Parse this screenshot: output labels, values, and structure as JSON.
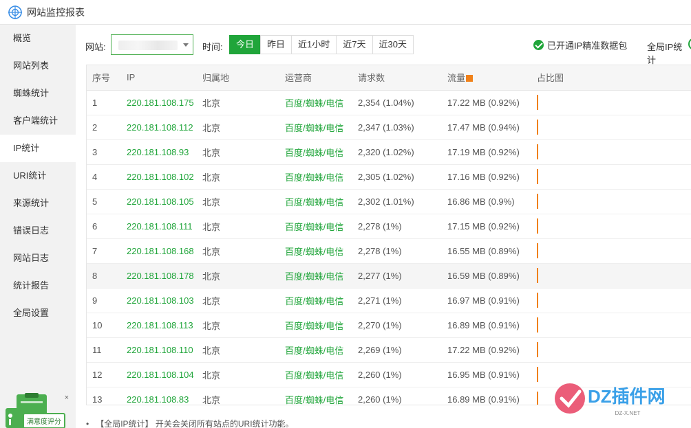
{
  "app": {
    "title": "网站监控报表"
  },
  "sidebar": {
    "items": [
      {
        "label": "概览"
      },
      {
        "label": "网站列表"
      },
      {
        "label": "蜘蛛统计"
      },
      {
        "label": "客户端统计"
      },
      {
        "label": "IP统计"
      },
      {
        "label": "URI统计"
      },
      {
        "label": "来源统计"
      },
      {
        "label": "错误日志"
      },
      {
        "label": "网站日志"
      },
      {
        "label": "统计报告"
      },
      {
        "label": "全局设置"
      }
    ],
    "active_index": 4
  },
  "promo": {
    "label": "满意度评分",
    "close": "×"
  },
  "toolbar": {
    "site_label": "网站:",
    "time_label": "时间:",
    "time_options": [
      "今日",
      "昨日",
      "近1小时",
      "近7天",
      "近30天"
    ],
    "time_active": "今日",
    "ip_data_label": "已开通IP精准数据包",
    "global_ip_label": "全局IP统计",
    "global_ip_on": true
  },
  "table": {
    "headers": [
      "序号",
      "IP",
      "归属地",
      "运营商",
      "请求数",
      "流量",
      "占比图"
    ],
    "rows": [
      [
        "1",
        "220.181.108.175",
        "北京",
        "百度/蜘蛛/电信",
        "2,354 (1.04%)",
        "17.22 MB (0.92%)"
      ],
      [
        "2",
        "220.181.108.112",
        "北京",
        "百度/蜘蛛/电信",
        "2,347 (1.03%)",
        "17.47 MB (0.94%)"
      ],
      [
        "3",
        "220.181.108.93",
        "北京",
        "百度/蜘蛛/电信",
        "2,320 (1.02%)",
        "17.19 MB (0.92%)"
      ],
      [
        "4",
        "220.181.108.102",
        "北京",
        "百度/蜘蛛/电信",
        "2,305 (1.02%)",
        "17.16 MB (0.92%)"
      ],
      [
        "5",
        "220.181.108.105",
        "北京",
        "百度/蜘蛛/电信",
        "2,302 (1.01%)",
        "16.86 MB (0.9%)"
      ],
      [
        "6",
        "220.181.108.111",
        "北京",
        "百度/蜘蛛/电信",
        "2,278 (1%)",
        "17.15 MB (0.92%)"
      ],
      [
        "7",
        "220.181.108.168",
        "北京",
        "百度/蜘蛛/电信",
        "2,278 (1%)",
        "16.55 MB (0.89%)"
      ],
      [
        "8",
        "220.181.108.178",
        "北京",
        "百度/蜘蛛/电信",
        "2,277 (1%)",
        "16.59 MB (0.89%)"
      ],
      [
        "9",
        "220.181.108.103",
        "北京",
        "百度/蜘蛛/电信",
        "2,271 (1%)",
        "16.97 MB (0.91%)"
      ],
      [
        "10",
        "220.181.108.113",
        "北京",
        "百度/蜘蛛/电信",
        "2,270 (1%)",
        "16.89 MB (0.91%)"
      ],
      [
        "11",
        "220.181.108.110",
        "北京",
        "百度/蜘蛛/电信",
        "2,269 (1%)",
        "17.22 MB (0.92%)"
      ],
      [
        "12",
        "220.181.108.104",
        "北京",
        "百度/蜘蛛/电信",
        "2,260 (1%)",
        "16.95 MB (0.91%)"
      ],
      [
        "13",
        "220.181.108.83",
        "北京",
        "百度/蜘蛛/电信",
        "2,260 (1%)",
        "16.89 MB (0.91%)"
      ]
    ],
    "highlight_row": 7
  },
  "footnote": {
    "bullet": "•",
    "text": "【全局IP统计】 开关会关闭所有站点的URI统计功能。"
  },
  "watermark": {
    "brand": "DZ插件网",
    "sub": "DZ-X.NET"
  },
  "colors": {
    "accent": "#20a53a",
    "bar": "#f0811a",
    "sidebar_bg": "#f2f2f2"
  },
  "icons": {
    "app": "monitor-logo-icon",
    "check": "check-circle-icon",
    "flow_sort": "sort-square-icon"
  }
}
